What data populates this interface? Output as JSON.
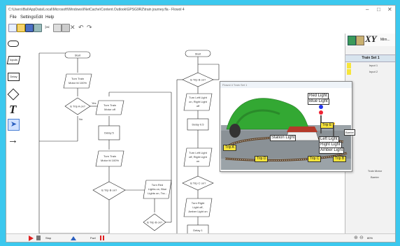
{
  "window": {
    "title": "C:\\Users\\Bal\\AppData\\Local\\Microsoft\\Windows\\INetCache\\Content.Outlook\\GPSG9RZ\\train journey.fla - Flowol 4",
    "min": "–",
    "max": "□",
    "close": "✕"
  },
  "menu": [
    "File",
    "Settings",
    "Edit",
    "Help"
  ],
  "toolbar_icons": [
    "new-icon",
    "open-icon",
    "save-icon",
    "print-icon",
    "cut-icon",
    "copy-icon",
    "paste-icon",
    "delete-icon",
    "undo-icon",
    "redo-icon"
  ],
  "palette_icons": [
    "start-end-shape-icon",
    "input-shape-icon",
    "delay-shape-icon",
    "decision-shape-icon",
    "text-tool-icon",
    "pointer-tool-icon",
    "connector-tool-icon"
  ],
  "palette_labels": {
    "input": "Inputs",
    "delay": "Delay"
  },
  "flow_left": {
    "start": "Start",
    "n1": [
      "Turn Train",
      "Motor fd 100%"
    ],
    "n2": "Is Trip A on?",
    "n3": [
      "Turn Train",
      "Motor off"
    ],
    "n4": "Delay 5",
    "n5": [
      "Turn Train",
      "Motor fd 100%"
    ],
    "n6": "Is Trip B on?",
    "n7": [
      "Turn Red",
      "Lights on, Blue",
      "Lights on, Tra..."
    ],
    "n8": "Is Trip B on?",
    "yes": "Yes",
    "no": "No"
  },
  "flow_right": {
    "start": "Start",
    "n1": "Is Trip B on?",
    "n2": [
      "Turn Left Light",
      "on, Right Light",
      "off"
    ],
    "n3": "Delay 0.5",
    "n4": [
      "Turn Left Light",
      "off, Right Light",
      "on"
    ],
    "n5": "Is Trip C on?",
    "n6": [
      "Turn Right",
      "Light off,",
      "Amber Light on"
    ],
    "n7": "Delay 1"
  },
  "popup": {
    "title": "Flowol 4 Train Set 1",
    "labels": {
      "trip_a": "Trip A",
      "trip_b": "Trip B",
      "trip_c": "Trip C",
      "trip_d": "Trip D",
      "trip_e": "Trip E",
      "station_light": "Station Light",
      "barrier": "Barrier",
      "left_light": "Left Light",
      "right_light": "Right Light",
      "amber_light": "Amber Light",
      "red_light": "Red Light",
      "blue_light": "Blue Light"
    }
  },
  "right_panel": {
    "xy": "XY",
    "mimic": "Mim...",
    "header": "Train Set 1",
    "items": [
      "Input 1",
      "Input 2"
    ],
    "outputs": [
      "Train Motor",
      "Barrier"
    ]
  },
  "status": {
    "stop": "Stop",
    "fwd": "Fwd",
    "zoom": "80%"
  },
  "colors": {
    "accent_blue": "#3cc8ee",
    "label_yellow": "#f7e53a",
    "grass_green": "#33a833",
    "stop_red": "#e02020"
  }
}
